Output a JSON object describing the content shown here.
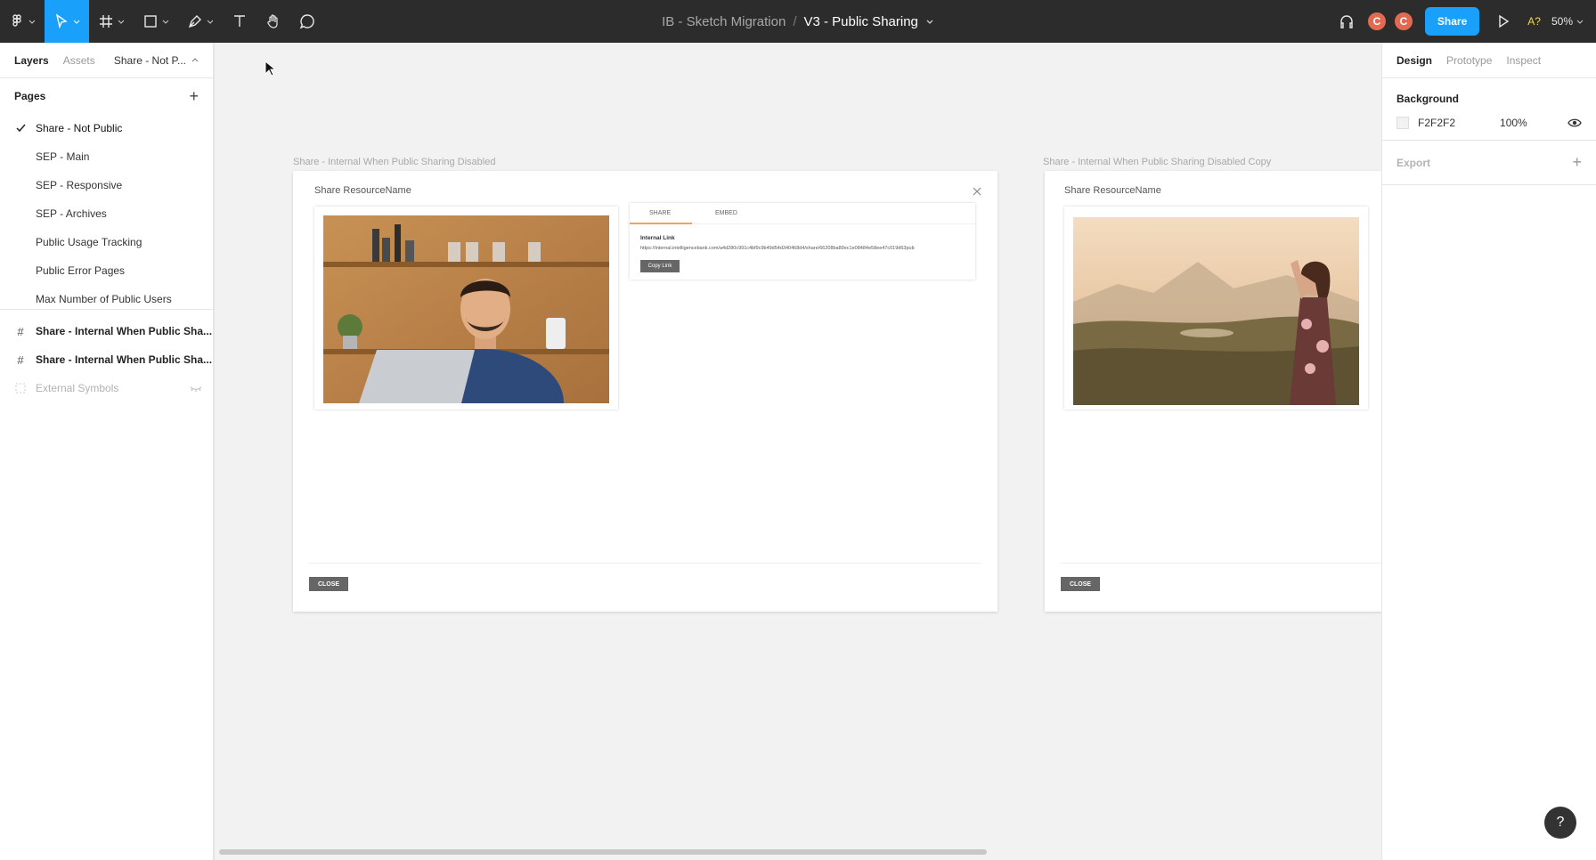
{
  "toolbar": {
    "project": "IB - Sketch Migration",
    "separator": "/",
    "file": "V3 - Public Sharing",
    "avatar1": "C",
    "avatar2": "C",
    "share_label": "Share",
    "access_badge": "A?",
    "zoom": "50%"
  },
  "left_panel": {
    "tabs": {
      "layers": "Layers",
      "assets": "Assets",
      "current_page": "Share - Not P..."
    },
    "pages_title": "Pages",
    "pages": [
      "Share - Not Public",
      "SEP - Main",
      "SEP - Responsive",
      "SEP - Archives",
      "Public Usage Tracking",
      "Public Error Pages",
      "Max Number of Public Users"
    ],
    "layers": [
      "Share - Internal When Public Sha...",
      "Share - Internal When Public Sha...",
      "External Symbols"
    ]
  },
  "canvas": {
    "frame1": {
      "label": "Share - Internal When Public Sharing Disabled",
      "title": "Share ResourceName",
      "tab_share": "SHARE",
      "tab_embed": "EMBED",
      "internal_link_label": "Internal Link",
      "url": "https://internal.intelligencebank.com/a4d280c991c4bf9c9b49d54d340468d4/share/66208ba89ec1e08484e58ee47c019d63pub",
      "copy_label": "Copy Link",
      "close_label": "CLOSE"
    },
    "frame2": {
      "label": "Share - Internal When Public Sharing Disabled Copy",
      "title": "Share ResourceName",
      "close_label": "CLOSE"
    }
  },
  "right_panel": {
    "tabs": {
      "design": "Design",
      "prototype": "Prototype",
      "inspect": "Inspect"
    },
    "background_title": "Background",
    "bg_hex": "F2F2F2",
    "bg_opacity": "100%",
    "export_title": "Export",
    "help": "?"
  },
  "colors": {
    "accent": "#18a0fb",
    "toolbar_bg": "#2c2c2c",
    "canvas_bg": "#f2f2f2",
    "avatar": "#e36a52",
    "tab_highlight": "#f0a35b"
  }
}
